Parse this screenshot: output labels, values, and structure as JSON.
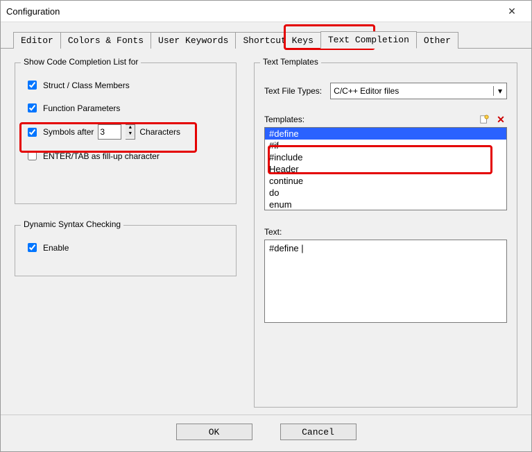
{
  "window": {
    "title": "Configuration"
  },
  "tabs": [
    "Editor",
    "Colors & Fonts",
    "User Keywords",
    "Shortcut Keys",
    "Text Completion",
    "Other"
  ],
  "activeTab": "Text Completion",
  "codeCompletion": {
    "title": "Show Code Completion List for",
    "struct": "Struct / Class Members",
    "func": "Function Parameters",
    "symbols_before": "Symbols after",
    "symbols_count": "3",
    "symbols_after": "Characters",
    "enter_tab": "ENTER/TAB as fill-up character"
  },
  "syntax": {
    "title": "Dynamic Syntax Checking",
    "enable": "Enable"
  },
  "templates": {
    "title": "Text Templates",
    "filetype_label": "Text File Types:",
    "filetype_value": "C/C++ Editor files",
    "templates_label": "Templates:",
    "items": [
      "#define",
      "#if",
      "#include",
      "Header",
      "continue",
      "do",
      "enum"
    ],
    "selected": "#define",
    "text_label": "Text:",
    "text_value": "#define |"
  },
  "buttons": {
    "ok": "OK",
    "cancel": "Cancel"
  }
}
